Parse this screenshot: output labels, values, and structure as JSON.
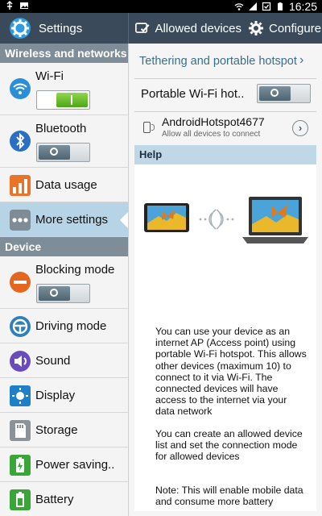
{
  "status_bar": {
    "time": "16:25",
    "icons": [
      "usb-icon",
      "image-icon",
      "wifi-signal-icon",
      "cell-signal-icon",
      "alarm-icon",
      "battery-icon"
    ]
  },
  "action_bar": {
    "title": "Settings",
    "allowed_devices_label": "Allowed devices",
    "configure_label": "Configure"
  },
  "sidebar": {
    "section_wireless": "Wireless and networks",
    "section_device": "Device",
    "items": {
      "wifi": {
        "label": "Wi-Fi",
        "toggle": "on"
      },
      "bluetooth": {
        "label": "Bluetooth",
        "toggle": "off"
      },
      "data_usage": {
        "label": "Data usage"
      },
      "more_settings": {
        "label": "More settings"
      },
      "blocking_mode": {
        "label": "Blocking mode",
        "toggle": "off"
      },
      "driving_mode": {
        "label": "Driving mode"
      },
      "sound": {
        "label": "Sound"
      },
      "display": {
        "label": "Display"
      },
      "storage": {
        "label": "Storage"
      },
      "power_saving": {
        "label": "Power saving.."
      },
      "battery": {
        "label": "Battery"
      }
    }
  },
  "main": {
    "breadcrumb": "Tethering and portable hotspot",
    "hotspot_label": "Portable Wi-Fi hot..",
    "hotspot_toggle": "off",
    "ap_name": "AndroidHotspot4677",
    "ap_subtitle": "Allow all devices to connect",
    "help_header": "Help",
    "help_paragraphs": [
      "You can use your device as an internet AP (Access point) using portable Wi-Fi hotspot. This allows other devices (maximum 10) to connect to it via Wi-Fi. The connected devices will have access to the internet via your data network",
      "You can create an allowed device list and set the connection mode for allowed devices",
      "Note: This will enable mobile data and consume more battery"
    ]
  },
  "colors": {
    "action_bar": "#3a4a5a",
    "section_header": "#7e8d98",
    "selected_item": "#b7d4e6",
    "link": "#3b6e8a",
    "toggle_on": "#4fa51b"
  }
}
